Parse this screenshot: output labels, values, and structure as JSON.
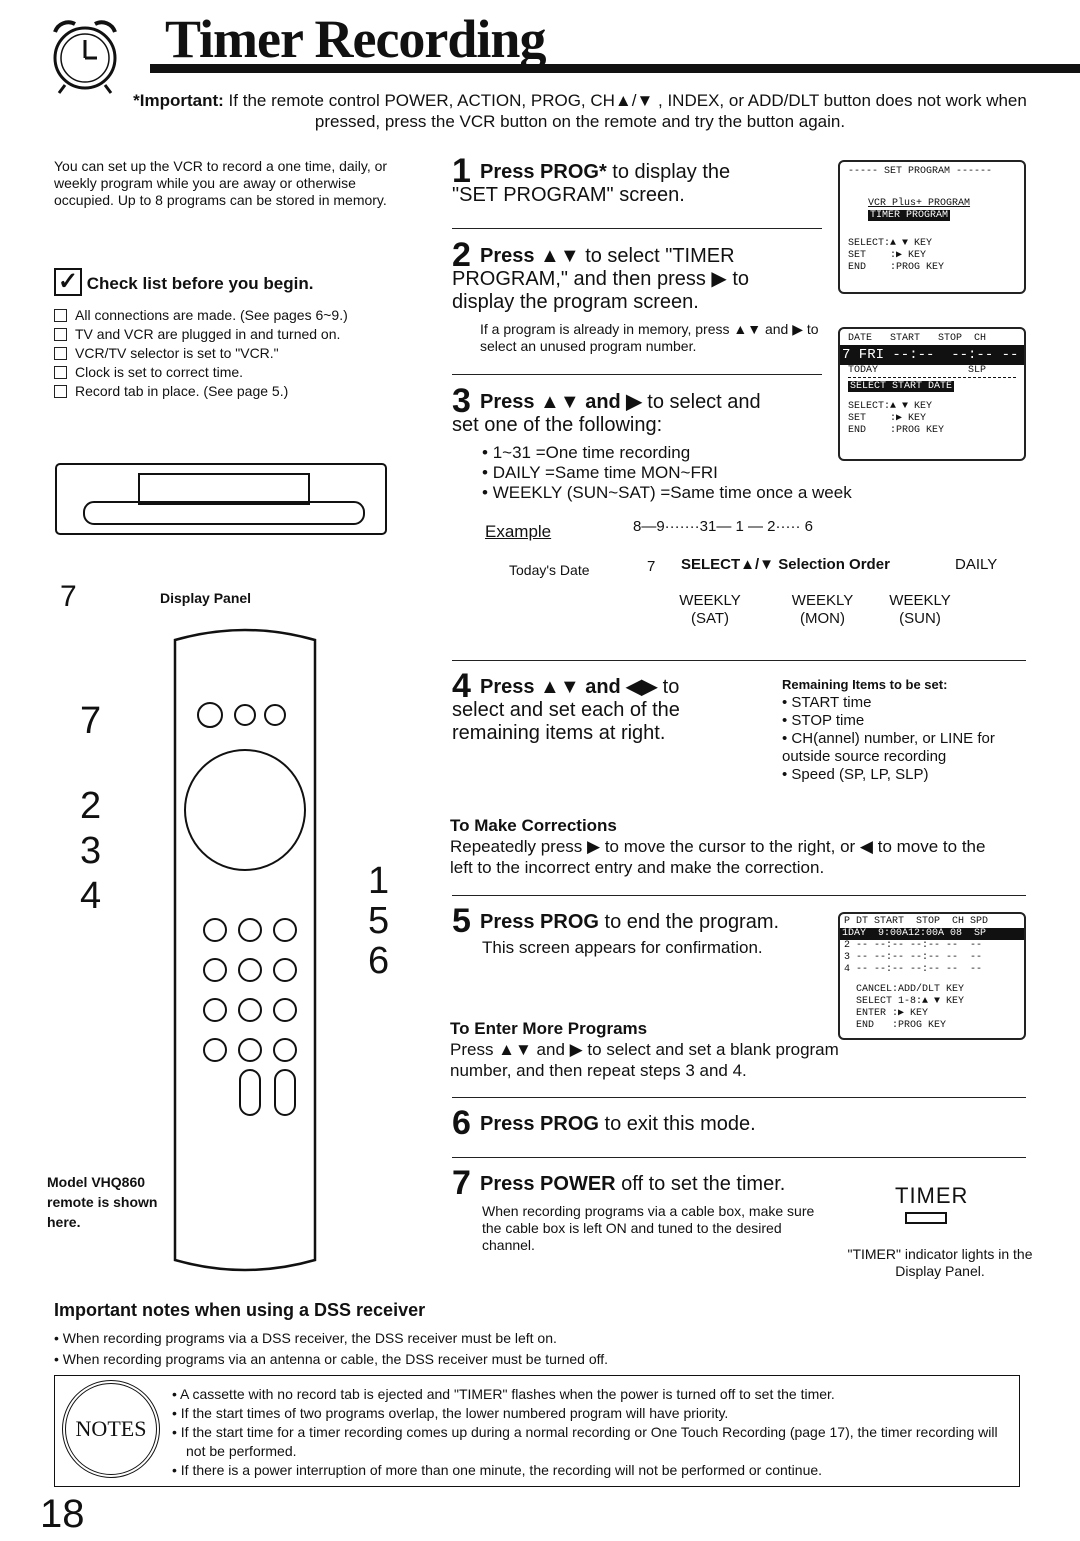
{
  "header": {
    "title": "Timer Recording",
    "icon": "alarm-clock-icon",
    "important_label": "*Important:",
    "important_text": "If the remote control POWER, ACTION, PROG, CH▲/▼ , INDEX, or ADD/DLT button does not work when pressed, press the VCR button on the remote and try the button again."
  },
  "intro": "You can set up the VCR to record a one time, daily, or weekly program while you are away or otherwise occupied. Up to 8 programs can be stored in memory.",
  "checklist": {
    "title": "Check list before you begin.",
    "items": [
      "All connections are made. (See pages 6~9.)",
      "TV and VCR are plugged in and turned on.",
      "VCR/TV selector is set to \"VCR.\"",
      "Clock is set to correct time.",
      "Record tab in place. (See page 5.)"
    ]
  },
  "vcr": {
    "callout": "7",
    "label": "Display Panel"
  },
  "remote": {
    "callouts_left": [
      "7",
      "2",
      "3",
      "4"
    ],
    "callouts_right": [
      "1",
      "5",
      "6"
    ],
    "caption": "Model VHQ860 remote is shown here."
  },
  "steps": [
    {
      "n": "1",
      "bold": "Press PROG*",
      "rest": " to display the \"SET PROGRAM\" screen."
    },
    {
      "n": "2",
      "bold": "Press ▲▼",
      "rest": " to select \"TIMER PROGRAM,\" and then press ▶ to display the program screen.",
      "note": "If a program is already in memory, press ▲▼ and ▶ to select an unused program number."
    },
    {
      "n": "3",
      "bold": "Press ▲▼ and ▶",
      "rest": " to select and set one of the following:",
      "options": [
        "1~31 =One time recording",
        "DAILY =Same time MON~FRI",
        "WEEKLY (SUN~SAT) =Same time once a week"
      ]
    },
    {
      "n": "4",
      "bold": "Press ▲▼ and ◀▶",
      "rest": " to select and set each of the remaining items at right."
    },
    {
      "n": "5",
      "bold": "Press PROG",
      "rest": " to end the program.",
      "note": "This screen appears for confirmation."
    },
    {
      "n": "6",
      "bold": "Press PROG",
      "rest": " to exit this mode."
    },
    {
      "n": "7",
      "bold": "Press POWER",
      "rest": " off to set the timer.",
      "note": "When recording programs via a cable box, make sure the cable box is left ON and tuned to the desired channel."
    }
  ],
  "example": {
    "label": "Example",
    "todays_date": "Today's Date",
    "date": "7",
    "sequence_top": "8—9·······31— 1 — 2····· 6",
    "selection_order": "SELECT▲/▼ Selection Order",
    "daily": "DAILY",
    "weekly_sat": "WEEKLY (SAT)",
    "weekly_mon": "WEEKLY (MON)",
    "weekly_sun": "WEEKLY (SUN)"
  },
  "remaining": {
    "title": "Remaining Items to be set:",
    "items": [
      "START time",
      "STOP time",
      "CH(annel) number, or LINE for outside source recording",
      "Speed (SP, LP, SLP)"
    ]
  },
  "corrections": {
    "title": "To Make Corrections",
    "text": "Repeatedly press ▶ to move the cursor to the right, or ◀ to move to the left to the incorrect entry and make the correction."
  },
  "more": {
    "title": "To Enter More Programs",
    "text": "Press ▲▼ and ▶ to select and set a blank program number, and then repeat steps 3 and 4."
  },
  "screens": {
    "s1": {
      "title": "----- SET PROGRAM ------",
      "l1": "VCR Plus+ PROGRAM",
      "l2": "TIMER PROGRAM",
      "k1": "SELECT:▲ ▼ KEY",
      "k2": "SET    :▶ KEY",
      "k3": "END    :PROG KEY"
    },
    "s2": {
      "head": "DATE   START   STOP  CH",
      "row": "7 FRI --:--  --:-- --",
      "sub": "TODAY               SLP",
      "msg": "SELECT START DATE",
      "k1": "SELECT:▲ ▼ KEY",
      "k2": "SET    :▶ KEY",
      "k3": "END    :PROG KEY"
    },
    "s3": {
      "head": "P DT START  STOP  CH SPD",
      "r1": "1DAY  9:00A12:00A 08  SP",
      "r2": "2 -- --:-- --:-- --  --",
      "r3": "3 -- --:-- --:-- --  --",
      "r4": "4 -- --:-- --:-- --  --",
      "k1": "CANCEL:ADD/DLT KEY",
      "k2": "SELECT 1-8:▲ ▼ KEY",
      "k3": "ENTER :▶ KEY",
      "k4": "END   :PROG KEY"
    }
  },
  "timer_indicator": {
    "label": "TIMER",
    "caption": "\"TIMER\" indicator lights in the Display Panel."
  },
  "dss": {
    "title": "Important notes when using a DSS receiver",
    "items": [
      "When recording programs via a DSS receiver, the DSS receiver must be left on.",
      "When recording programs via an antenna or cable, the DSS receiver must be turned off."
    ]
  },
  "notes": {
    "badge": "NOTES",
    "items": [
      "A cassette with no record tab is ejected and \"TIMER\" flashes when the power is turned off to set the timer.",
      "If the start times of two programs overlap, the lower numbered program will have priority.",
      "If the start time for a timer recording comes up during a normal recording or One Touch Recording (page 17), the timer recording will not be performed.",
      "If there is a power interruption of more than one minute, the recording will not be performed or continue."
    ]
  },
  "page_number": "18"
}
